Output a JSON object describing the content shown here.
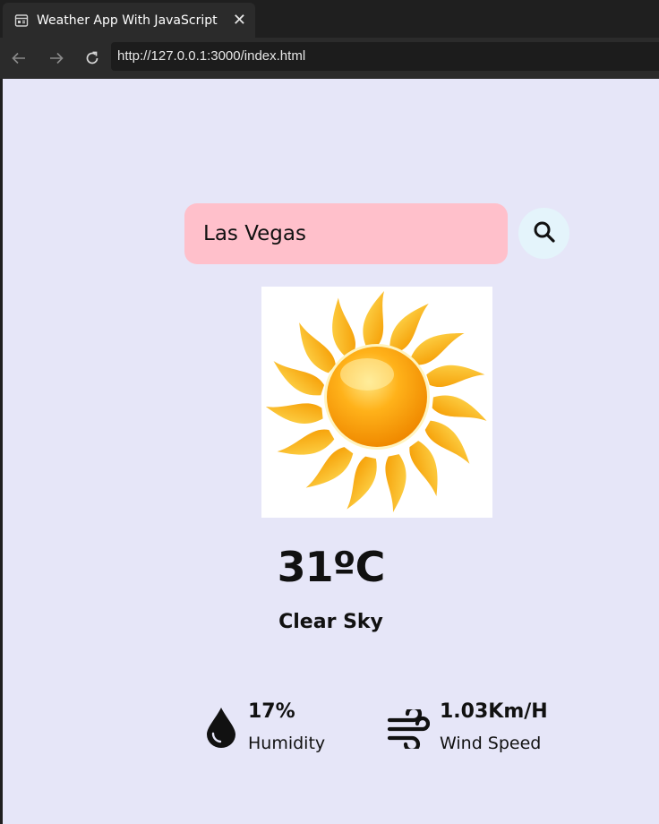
{
  "browser": {
    "tab_title": "Weather App With JavaScript",
    "tab_icon": "page-icon",
    "url": "http://127.0.0.1:3000/index.html"
  },
  "search": {
    "value": "Las Vegas",
    "button_icon": "search-icon"
  },
  "weather": {
    "image": "sun-icon",
    "temperature": "31ºC",
    "condition": "Clear Sky"
  },
  "details": {
    "humidity": {
      "value": "17%",
      "label": "Humidity",
      "icon": "water-drop-icon"
    },
    "wind": {
      "value": "1.03Km/H",
      "label": "Wind Speed",
      "icon": "wind-icon"
    }
  },
  "colors": {
    "page_background": "#e6e6f8",
    "search_input_background": "#ffc0cb",
    "search_button_background": "#e4f4fb",
    "sun_orange": "#ffa500"
  }
}
